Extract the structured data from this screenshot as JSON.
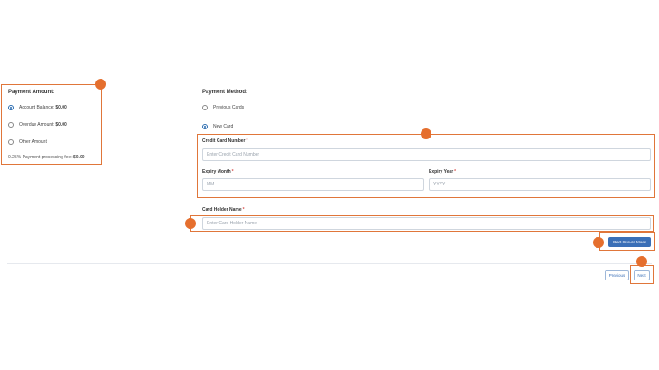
{
  "payment_amount": {
    "title": "Payment Amount:",
    "options": [
      {
        "label": "Account Balance:",
        "amount": "$0.00",
        "selected": true
      },
      {
        "label": "Overdue Amount:",
        "amount": "$0.00",
        "selected": false
      },
      {
        "label": "Other Amount",
        "amount": "",
        "selected": false
      }
    ],
    "fee_label": "0.25% Payment processing fee:",
    "fee_value": "$0.00"
  },
  "payment_method": {
    "title": "Payment Method:",
    "options": [
      {
        "label": "Previous Cards",
        "selected": false
      },
      {
        "label": "New Card",
        "selected": true
      }
    ]
  },
  "card_form": {
    "card_number_label": "Credit Card Number",
    "card_number_placeholder": "Enter Credit Card Number",
    "expiry_month_label": "Expiry Month",
    "expiry_month_placeholder": "MM",
    "expiry_year_label": "Expiry Year",
    "expiry_year_placeholder": "YYYY",
    "holder_name_label": "Card Holder Name",
    "holder_name_placeholder": "Enter Card Holder Name",
    "required_mark": "*"
  },
  "buttons": {
    "secure_mode": "Start Secure Mode",
    "previous": "Previous",
    "next": "Next"
  },
  "colors": {
    "accent": "#3a6fb7",
    "annotation": "#e56f2e"
  }
}
